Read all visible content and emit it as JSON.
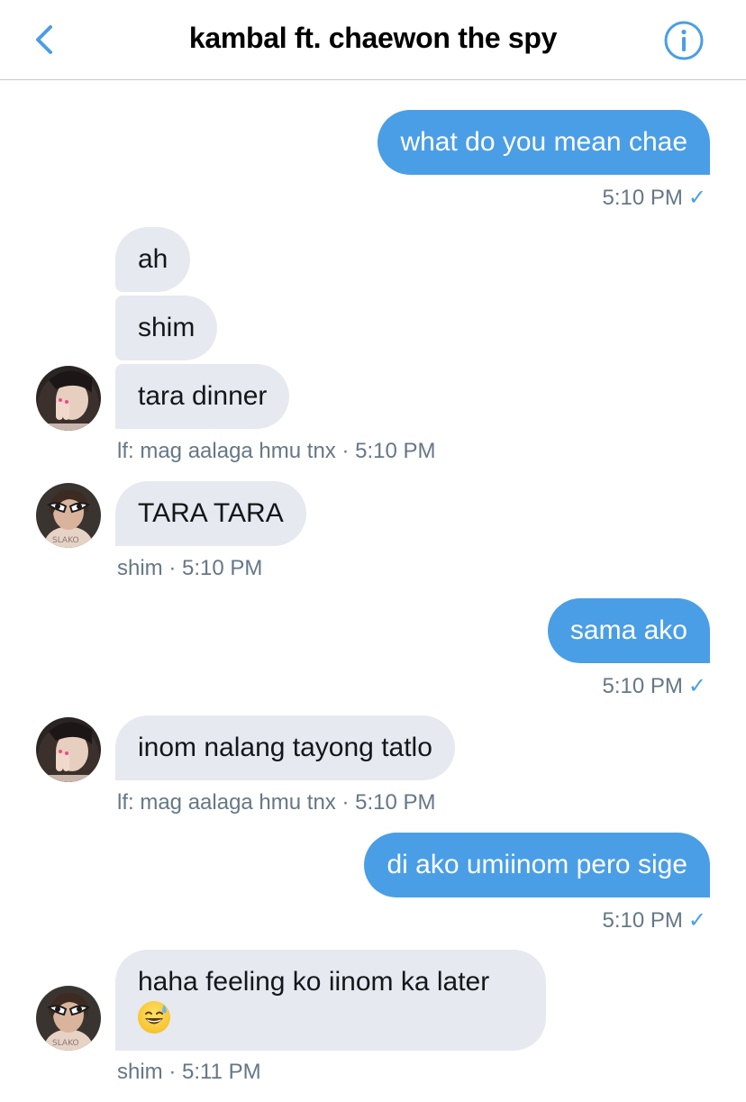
{
  "header": {
    "title": "kambal ft. chaewon the spy",
    "back_icon": "chevron-left-icon",
    "info_icon": "info-icon",
    "accent_color": "#4a9ee6"
  },
  "messages": [
    {
      "direction": "out",
      "text": "what do you mean chae",
      "time": "5:10 PM",
      "status_icon": "checkmark-icon"
    },
    {
      "direction": "in",
      "text": "ah"
    },
    {
      "direction": "in",
      "text": "shim"
    },
    {
      "direction": "in",
      "text": "tara dinner",
      "sender_meta": "lf: mag aalaga hmu tnx · 5:10 PM"
    },
    {
      "direction": "in",
      "text": "TARA TARA",
      "sender_meta": "shim · 5:10 PM"
    },
    {
      "direction": "out",
      "text": "sama ako",
      "time": "5:10 PM",
      "status_icon": "checkmark-icon"
    },
    {
      "direction": "in",
      "text": "inom nalang tayong tatlo",
      "sender_meta": "lf: mag aalaga hmu tnx · 5:10 PM"
    },
    {
      "direction": "out",
      "text": "di ako umiinom pero sige",
      "time": "5:10 PM",
      "status_icon": "checkmark-icon"
    },
    {
      "direction": "in",
      "text": "haha feeling ko iinom ka later",
      "emoji": "sweat-smile-emoji",
      "sender_meta": "shim · 5:11 PM"
    }
  ],
  "colors": {
    "outgoing_bubble": "#4a9ee6",
    "incoming_bubble": "#e6e9ef",
    "meta_text": "#657786"
  }
}
